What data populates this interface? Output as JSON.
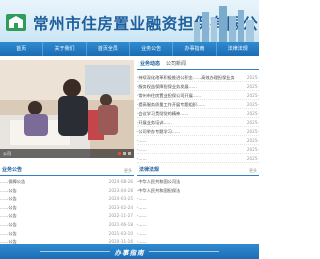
{
  "header": {
    "title": "常州市住房置业融资担保有限公司",
    "brand_color": "#1f5f9c"
  },
  "nav": {
    "items": [
      "首页",
      "关于我们",
      "首页全员",
      "业务公告",
      "办事指南",
      "法律法规"
    ]
  },
  "photo": {
    "caption": "公司"
  },
  "news": {
    "tabs": [
      "业务动态",
      "公司新闻"
    ],
    "items": [
      {
        "title": "·持续深化改革积极推进公积金……高效办理担保业务",
        "date": "2025-"
      },
      {
        "title": "·服务权益保障担保业务发展……",
        "date": "2025-"
      },
      {
        "title": "·常州市住房置业担保公司开展……",
        "date": "2025-"
      },
      {
        "title": "·提高服务质量工作开展专题组织……",
        "date": "2025-"
      },
      {
        "title": "·会议学习贯彻党的精神……",
        "date": "2025-"
      },
      {
        "title": "·开展业务培训……",
        "date": "2025-"
      },
      {
        "title": "·公司举办专题学习……",
        "date": "2025-"
      },
      {
        "title": "·……",
        "date": "2025-"
      },
      {
        "title": "·……",
        "date": "2025-"
      },
      {
        "title": "·……",
        "date": "2025-"
      }
    ]
  },
  "notice": {
    "title": "业务公告",
    "more": "更多",
    "items": [
      {
        "title": "……保障公告",
        "date": "2024-08-26"
      },
      {
        "title": "……公告",
        "date": "2023-04-28"
      },
      {
        "title": "……公告",
        "date": "2024-03-25"
      },
      {
        "title": "……公告",
        "date": "2023-02-24"
      },
      {
        "title": "……公告",
        "date": "2022-11-27"
      },
      {
        "title": "……公告",
        "date": "2021-06-18"
      },
      {
        "title": "……公告",
        "date": "2021-03-10"
      },
      {
        "title": "……公告",
        "date": "2020-11-16"
      }
    ]
  },
  "law": {
    "title": "法律法规",
    "more": "更多",
    "items": [
      {
        "title": "·中华人民共和国公司法",
        "date": ""
      },
      {
        "title": "·中华人民共和国担保法",
        "date": ""
      },
      {
        "title": "·……",
        "date": ""
      },
      {
        "title": "·……",
        "date": ""
      },
      {
        "title": "·……",
        "date": ""
      },
      {
        "title": "·……",
        "date": ""
      },
      {
        "title": "·……",
        "date": ""
      },
      {
        "title": "·……",
        "date": ""
      }
    ]
  },
  "guide": {
    "text": "办事指南"
  }
}
